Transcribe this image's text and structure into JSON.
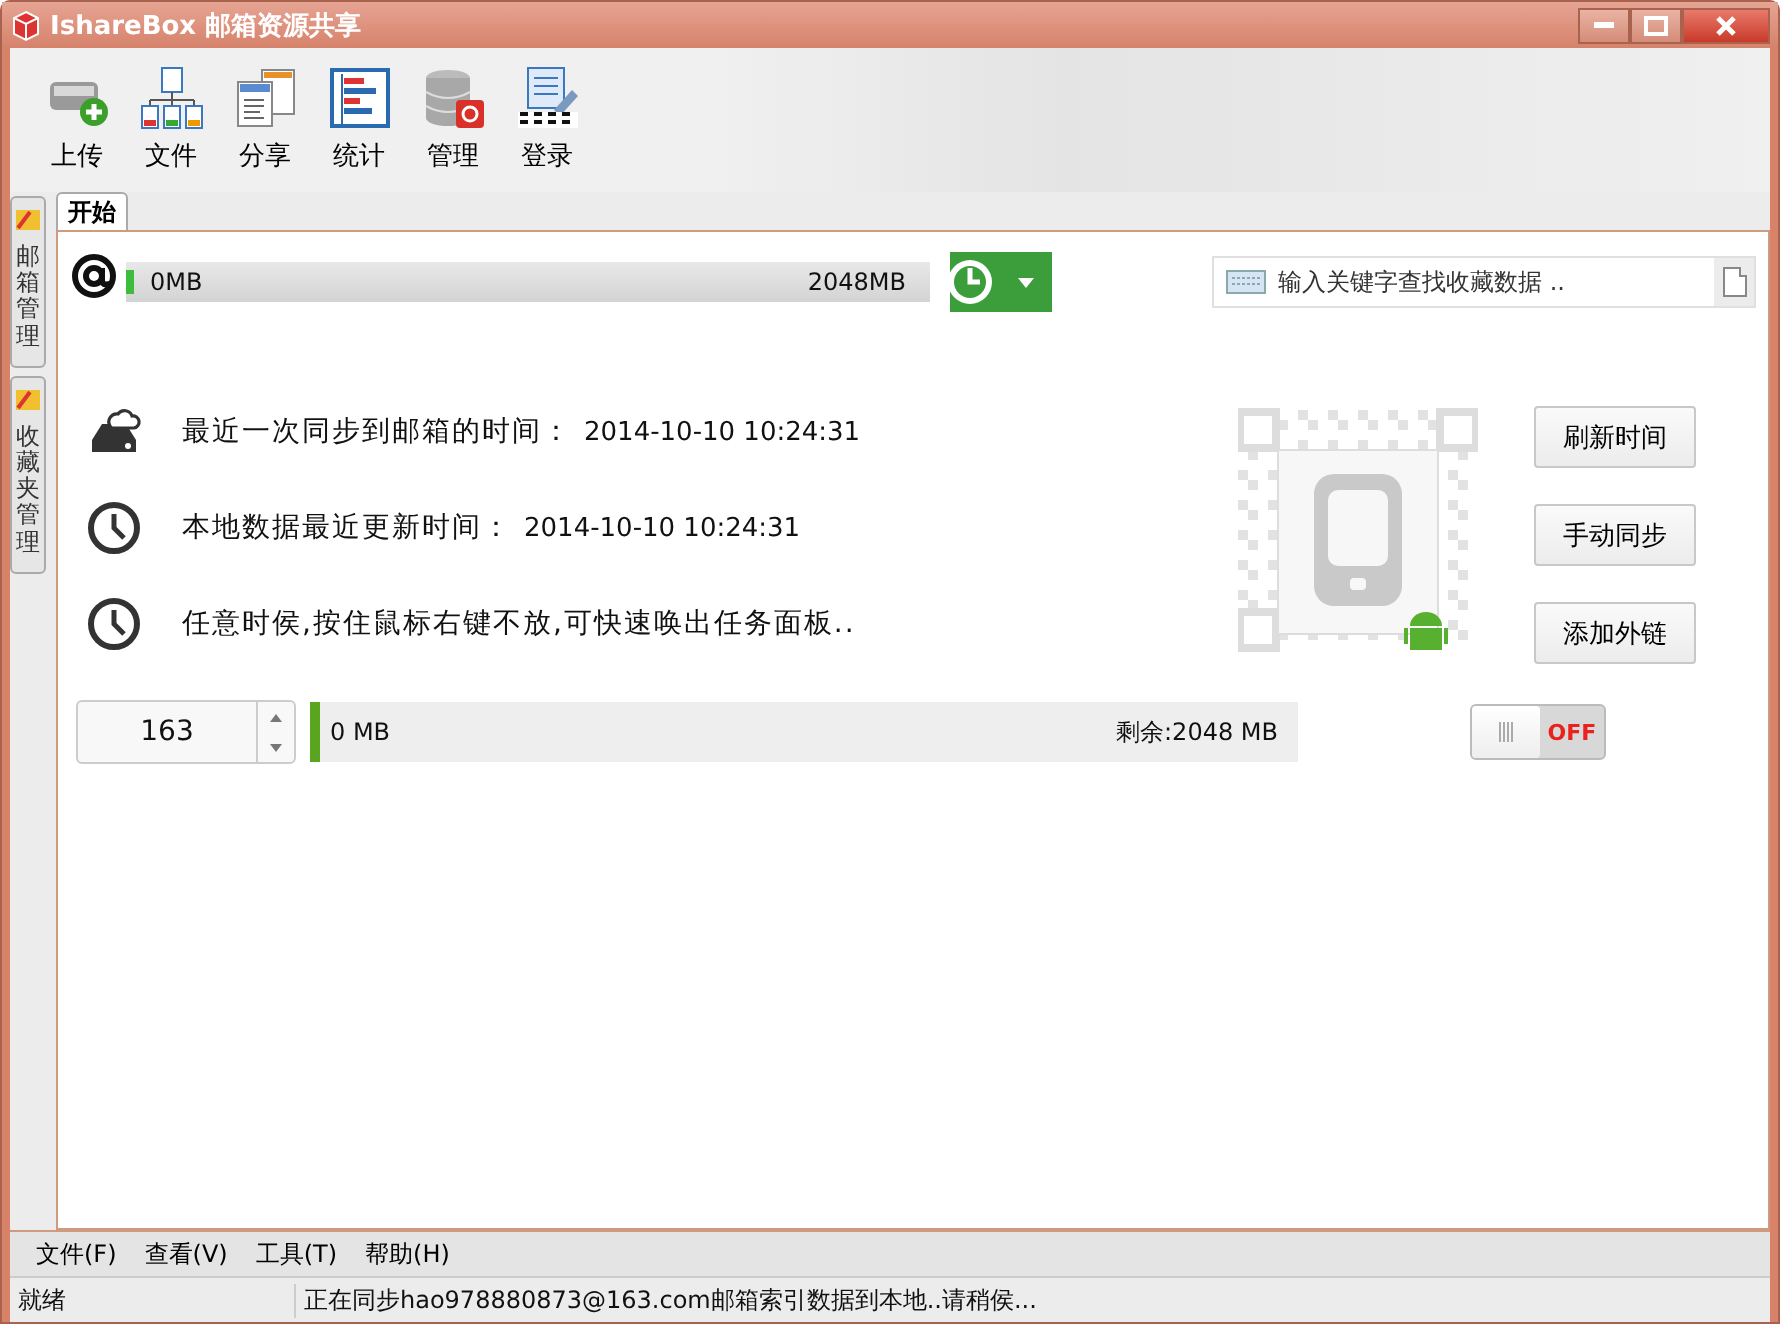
{
  "window": {
    "title": "IshareBox 邮箱资源共享"
  },
  "toolbar": [
    {
      "kind": "upload",
      "label": "上传"
    },
    {
      "kind": "files",
      "label": "文件"
    },
    {
      "kind": "share",
      "label": "分享"
    },
    {
      "kind": "stats",
      "label": "统计"
    },
    {
      "kind": "manage",
      "label": "管理"
    },
    {
      "kind": "login",
      "label": "登录"
    }
  ],
  "side_tabs": [
    {
      "label": "邮箱管理"
    },
    {
      "label": "收藏夹管理"
    }
  ],
  "tabs": [
    {
      "label": "开始",
      "selected": true
    }
  ],
  "quota": {
    "used": "0MB",
    "total": "2048MB",
    "level": 0.01
  },
  "search": {
    "placeholder": "输入关键字查找收藏数据 .."
  },
  "info_rows": [
    {
      "kind": "cloud",
      "label": "最近一次同步到邮箱的时间：",
      "value": "2014-10-10 10:24:31"
    },
    {
      "kind": "clock",
      "label": "本地数据最近更新时间：",
      "value": "2014-10-10 10:24:31"
    },
    {
      "kind": "clock",
      "label": "任意时侯,按住鼠标右键不放,可快速唤出任务面板.."
    }
  ],
  "buttons": [
    "刷新时间",
    "手动同步",
    "添加外链"
  ],
  "spinner": {
    "value": "163"
  },
  "usage": {
    "used": "0 MB",
    "remaining": "剩余:2048 MB",
    "level": 0.01
  },
  "toggle": {
    "on": false,
    "label": "OFF"
  },
  "menu": [
    "文件(F)",
    "查看(V)",
    "工具(T)",
    "帮助(H)"
  ],
  "status_bar": [
    "就绪",
    "正在同步hao978880873@163.com邮箱索引数据到本地..请稍侯..."
  ]
}
